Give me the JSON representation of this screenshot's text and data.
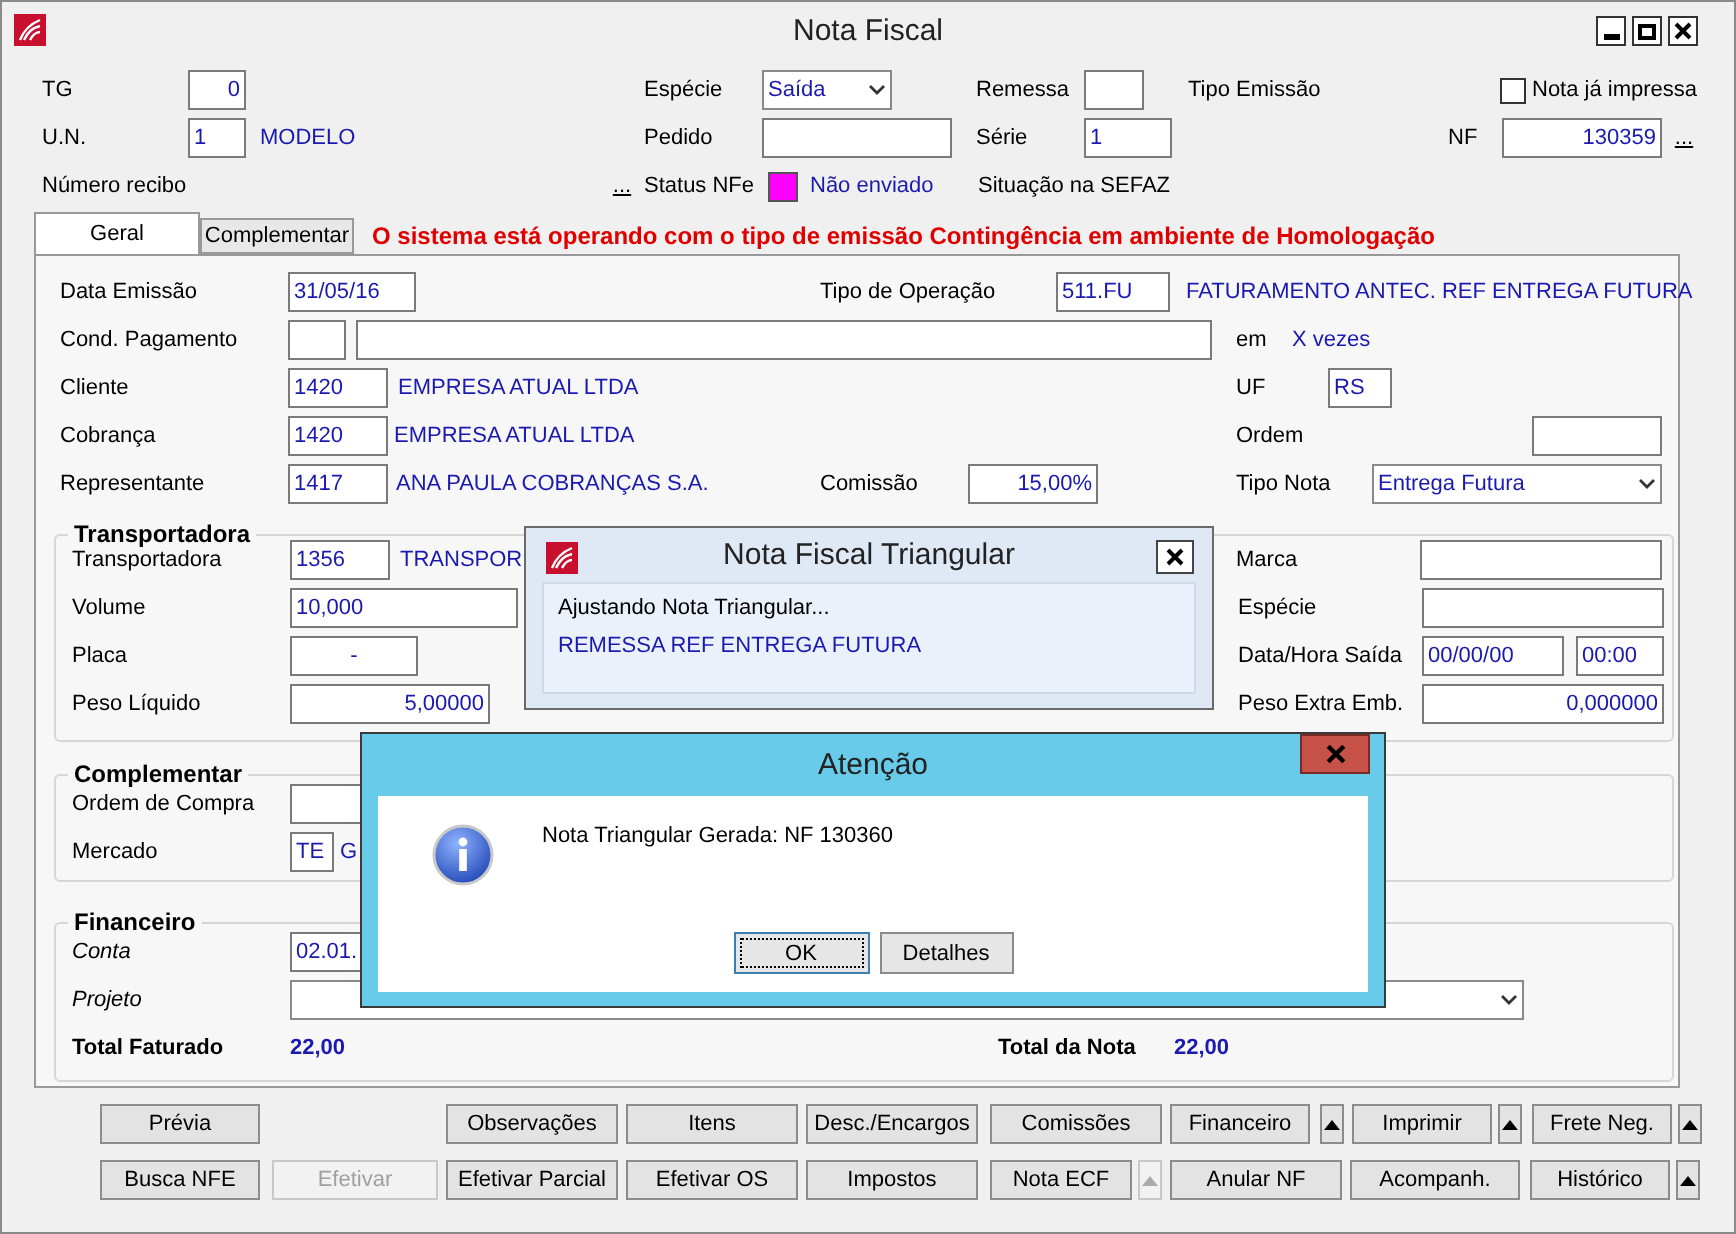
{
  "window": {
    "title": "Nota Fiscal"
  },
  "header": {
    "tg": {
      "label": "TG",
      "value": "0"
    },
    "especie": {
      "label": "Espécie",
      "value": "Saída"
    },
    "remessa": {
      "label": "Remessa"
    },
    "tipo_emissao": {
      "label": "Tipo Emissão"
    },
    "nota_impressa": {
      "label": "Nota já impressa",
      "checked": false
    },
    "un": {
      "label": "U.N.",
      "value": "1",
      "name": "MODELO"
    },
    "pedido": {
      "label": "Pedido"
    },
    "serie": {
      "label": "Série",
      "value": "1"
    },
    "nf": {
      "label": "NF",
      "value": "130359",
      "button": "..."
    },
    "numero_recibo": {
      "label": "Número recibo",
      "button": "..."
    },
    "status_nfe": {
      "label": "Status NFe",
      "color": "#ff00ff",
      "text": "Não enviado"
    },
    "situacao_sefaz": {
      "label": "Situação na SEFAZ"
    }
  },
  "tabs": [
    {
      "label": "Geral",
      "selected": true
    },
    {
      "label": "Complementar",
      "selected": false
    }
  ],
  "warning": "O sistema está operando com o tipo de emissão Contingência em ambiente de Homologação",
  "geral": {
    "data_emissao": {
      "label": "Data Emissão",
      "value": "31/05/16"
    },
    "tipo_operacao": {
      "label": "Tipo de Operação",
      "value": "511.FU",
      "name": "FATURAMENTO ANTEC. REF ENTREGA FUTURA"
    },
    "cond_pagamento": {
      "label": "Cond. Pagamento"
    },
    "parcelas": {
      "label": "em",
      "value": "X vezes"
    },
    "cliente": {
      "label": "Cliente",
      "value": "1420",
      "name": "EMPRESA ATUAL LTDA"
    },
    "uf": {
      "label": "UF",
      "value": "RS"
    },
    "cobranca": {
      "label": "Cobrança",
      "value": "1420",
      "name": "EMPRESA ATUAL LTDA"
    },
    "ordem": {
      "label": "Ordem"
    },
    "representante": {
      "label": "Representante",
      "value": "1417",
      "name": "ANA PAULA COBRANÇAS S.A."
    },
    "comissao": {
      "label": "Comissão",
      "value": "15,00%"
    },
    "tipo_nota": {
      "label": "Tipo Nota",
      "value": "Entrega Futura"
    }
  },
  "transportadora": {
    "title": "Transportadora",
    "transportadora": {
      "label": "Transportadora",
      "value": "1356",
      "name": "TRANSPOR"
    },
    "marca": {
      "label": "Marca"
    },
    "volume": {
      "label": "Volume",
      "value": "10,000"
    },
    "especie": {
      "label": "Espécie"
    },
    "placa": {
      "label": "Placa",
      "value": "-"
    },
    "data_hora_saida": {
      "label": "Data/Hora Saída",
      "date": "00/00/00",
      "time": "00:00"
    },
    "peso_liquido": {
      "label": "Peso Líquido",
      "value": "5,00000"
    },
    "peso_extra": {
      "label": "Peso Extra Emb.",
      "value": "0,000000"
    }
  },
  "complementar": {
    "title": "Complementar",
    "ordem_compra": {
      "label": "Ordem de Compra"
    },
    "mercado": {
      "label": "Mercado",
      "value": "TE",
      "name": "G"
    }
  },
  "financeiro": {
    "title": "Financeiro",
    "conta": {
      "label": "Conta",
      "value": "02.01."
    },
    "projeto": {
      "label": "Projeto"
    },
    "total_faturado": {
      "label": "Total Faturado",
      "value": "22,00"
    },
    "total_nota": {
      "label": "Total da Nota",
      "value": "22,00"
    }
  },
  "toolbar": {
    "rows": [
      [
        {
          "kind": "button",
          "label": "Prévia",
          "disabled": false
        },
        {
          "kind": "empty"
        },
        {
          "kind": "button",
          "label": "Observações",
          "disabled": false
        },
        {
          "kind": "button",
          "label": "Itens",
          "disabled": false
        },
        {
          "kind": "button",
          "label": "Desc./Encargos",
          "disabled": false
        },
        {
          "kind": "button",
          "label": "Comissões",
          "disabled": false
        },
        {
          "kind": "button",
          "label": "Financeiro",
          "disabled": false
        },
        {
          "kind": "arrow",
          "disabled": false
        },
        {
          "kind": "button",
          "label": "Imprimir",
          "disabled": false
        },
        {
          "kind": "arrow",
          "disabled": false
        },
        {
          "kind": "button",
          "label": "Frete Neg.",
          "disabled": false
        },
        {
          "kind": "arrow",
          "disabled": false
        }
      ],
      [
        {
          "kind": "button",
          "label": "Busca NFE",
          "disabled": false
        },
        {
          "kind": "button",
          "label": "Efetivar",
          "disabled": true
        },
        {
          "kind": "button",
          "label": "Efetivar Parcial",
          "disabled": false
        },
        {
          "kind": "button",
          "label": "Efetivar OS",
          "disabled": false
        },
        {
          "kind": "button",
          "label": "Impostos",
          "disabled": false
        },
        {
          "kind": "button",
          "label": "Nota ECF",
          "disabled": false
        },
        {
          "kind": "arrow",
          "disabled": true
        },
        {
          "kind": "button",
          "label": "Anular NF",
          "disabled": false
        },
        {
          "kind": "button",
          "label": "Acompanh.",
          "disabled": false
        },
        {
          "kind": "button",
          "label": "Histórico",
          "disabled": false
        },
        {
          "kind": "arrow",
          "disabled": false
        }
      ]
    ]
  },
  "triangular_dialog": {
    "title": "Nota Fiscal Triangular",
    "lines": [
      {
        "kind": "status",
        "text": "Ajustando Nota Triangular..."
      },
      {
        "kind": "info",
        "text": "REMESSA REF ENTREGA FUTURA"
      }
    ]
  },
  "alert_dialog": {
    "title": "Atenção",
    "message": "Nota Triangular Gerada: NF 130360",
    "buttons": [
      {
        "label": "OK",
        "default": true
      },
      {
        "label": "Detalhes",
        "default": false
      }
    ]
  }
}
